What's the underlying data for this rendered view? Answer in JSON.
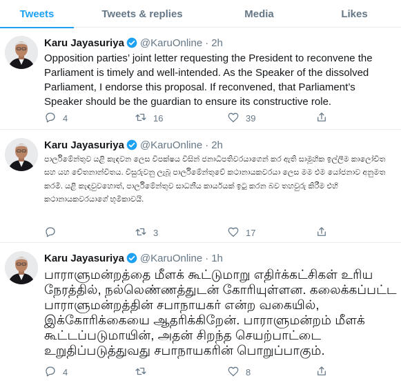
{
  "tabs": [
    {
      "label": "Tweets"
    },
    {
      "label": "Tweets & replies"
    },
    {
      "label": "Media"
    },
    {
      "label": "Likes"
    }
  ],
  "colors": {
    "accent": "#1da1f2",
    "muted": "#657786",
    "text": "#14171a",
    "divider": "#e6ecf0"
  },
  "tweets": [
    {
      "name": "Karu Jayasuriya",
      "handle": "@KaruOnline",
      "separator": "·",
      "time": "2h",
      "text": "Opposition parties’ joint letter requesting the President to reconvene the Parliament is timely and well-intended. As the Speaker of the dissolved Parliament, I endorse this proposal. If reconvened, that Parliament’s Speaker should be the guardian to ensure its constructive role.",
      "replies": "4",
      "retweets": "16",
      "likes": "39"
    },
    {
      "name": "Karu Jayasuriya",
      "handle": "@KaruOnline",
      "separator": "·",
      "time": "2h",
      "text": "පාර්ලිමේන්තුව යළි කැඳවන ලෙස විපක්ෂය විසින් ජනාධිපතිවරයාගෙන් කර ඇති සාමූහික ඉල්ලීම කාලෝචිත සහ යහ චේතනාන්විතය. විසුරුවනු ලැබූ පාර්ලිමේන්තුවේ කථානායකවරයා ලෙස මම එම යෝජනාව අනුමත කරමි. යළි කැඳවුවහොත්, පාර්ලිමේන්තුව සාධනීය කාර්යයක් ඉටු කරන බව තහවුරු කිරීම එහි කථානායකවරයාගේ භූමිකාවයි.",
      "replies": "",
      "retweets": "3",
      "likes": "17"
    },
    {
      "name": "Karu Jayasuriya",
      "handle": "@KaruOnline",
      "separator": "·",
      "time": "1h",
      "text": "பாராளுமன்றத்தை மீளக் கூட்டுமாறு எதிர்க்கட்சிகள் உரிய நேரத்தில், நல்லெண்ணத்துடன் கோரியுள்ளன. கலைக்கப்பட்ட பாராளுமன்றத்தின் சபாநாயகர் என்ற வகையில், இக்கோரிக்கையை ஆதரிக்கிறேன். பாராளுமன்றம் மீளக் கூட்டப்படுமாயின், அதன் சிறந்த செயற்பாட்டை உறுதிப்படுத்துவது சபாநாயகரின் பொறுப்பாகும்.",
      "replies": "4",
      "retweets": "",
      "likes": "8"
    }
  ]
}
